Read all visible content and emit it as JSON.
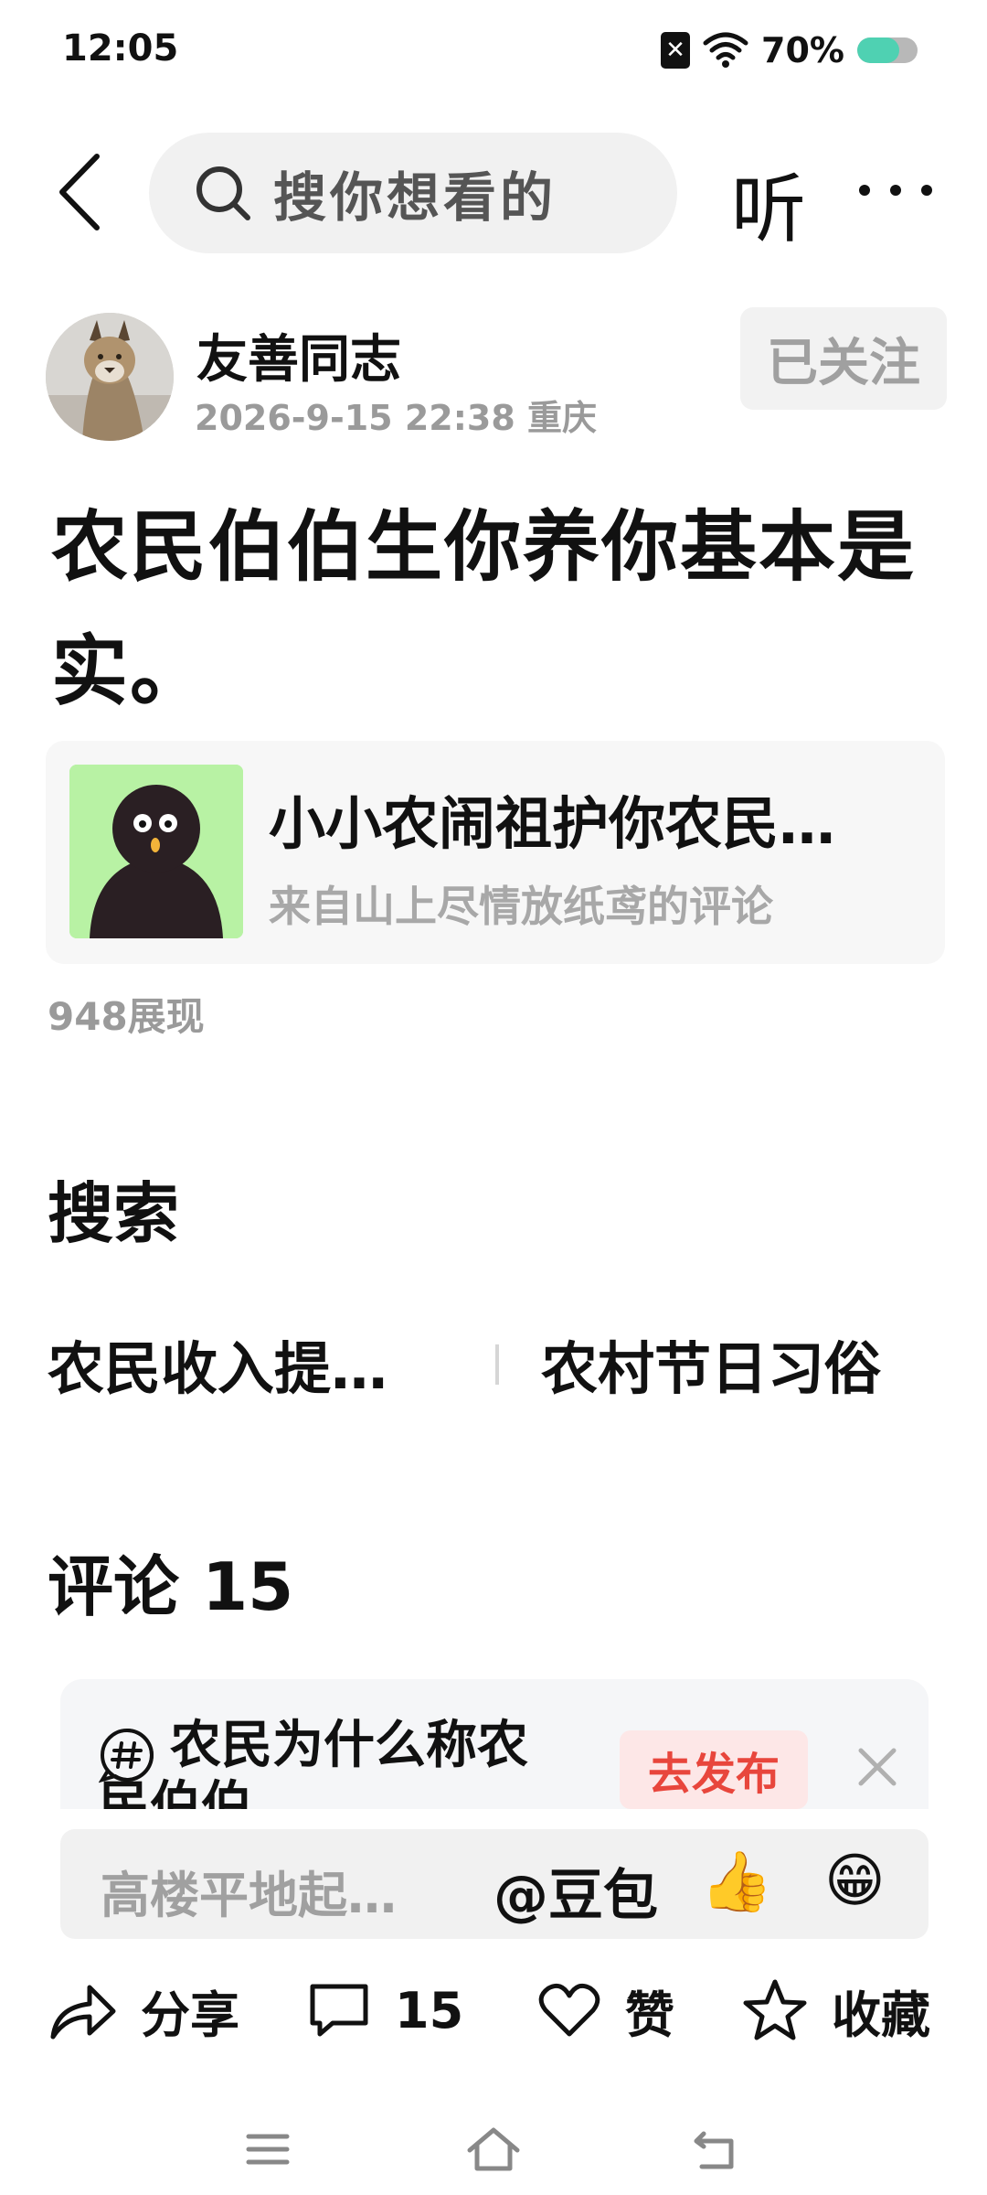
{
  "status": {
    "time": "12:05",
    "battery_percent": "70%",
    "battery_level": 0.7,
    "sim_glyph": "✕"
  },
  "top_bar": {
    "search_placeholder": "搜你想看的",
    "listen_label": "听",
    "icons": [
      "back-arrow-icon",
      "search-icon",
      "more-icon"
    ]
  },
  "author": {
    "name": "友善同志",
    "meta": "2026-9-15  22:38  重庆",
    "follow_label": "已关注"
  },
  "post": {
    "text": "农民伯伯生你养你基本是实。",
    "quote_title": "小小农闹祖护你农民…",
    "quote_source": "来自山上尽情放纸鸢的评论",
    "views": "948展现"
  },
  "search_section": {
    "title": "搜索",
    "tags": [
      "农民收入提…",
      "农村节日习俗"
    ]
  },
  "comments": {
    "title": "评论 15",
    "prompt_text": "农民为什么称农民伯伯",
    "publish_label": "去发布",
    "input_placeholder": "高楼平地起…",
    "mention_label": "@豆包",
    "emoji_thumb": "👍",
    "emoji_grin": "😁"
  },
  "actions": {
    "share_label": "分享",
    "comment_count": "15",
    "like_label": "赞",
    "favorite_label": "收藏"
  },
  "colors": {
    "publish_red": "#e8463c",
    "battery_green": "#4fd1b2",
    "quote_thumb_green": "#b8f2a4"
  }
}
